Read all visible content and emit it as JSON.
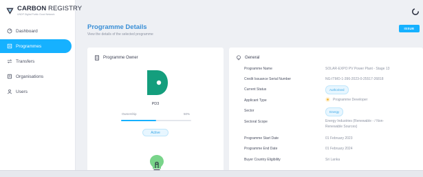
{
  "app": {
    "logo_title_bold": "CARBON",
    "logo_title_light": " REGISTRY",
    "logo_subtitle": "UNDP Digital Public Good Network"
  },
  "sidebar": {
    "items": [
      {
        "label": "Dashboard",
        "icon": "dashboard-icon",
        "active": false
      },
      {
        "label": "Programmes",
        "icon": "programmes-icon",
        "active": true
      },
      {
        "label": "Transfers",
        "icon": "transfers-icon",
        "active": false
      },
      {
        "label": "Organisations",
        "icon": "organisations-icon",
        "active": false
      },
      {
        "label": "Users",
        "icon": "users-icon",
        "active": false
      }
    ]
  },
  "header": {
    "title": "Programme Details",
    "subtitle": "View the details of the selected programme",
    "issue_label": "ISSUE"
  },
  "owner": {
    "heading": "Programme Owner",
    "name": "PD3",
    "ownership_label": "Ownership",
    "ownership_value": "50%",
    "ownership_fraction": 0.5,
    "status": "Active"
  },
  "general": {
    "heading": "General",
    "rows": [
      {
        "label": "Programme Name",
        "value": "SOLAR-EXPO PV Power Plant - Stage 13"
      },
      {
        "label": "Credit Issuance Serial Number",
        "value": "NG-ITMO-1-396-2023-0-25517-26818"
      },
      {
        "label": "Current Status",
        "value": "Authorised"
      },
      {
        "label": "Applicant Type",
        "value": "Programme Developer"
      },
      {
        "label": "Sector",
        "value": "Energy"
      },
      {
        "label": "Sectoral Scope",
        "value": "Energy Industries (Renewable - / Non-Renewable Sources)"
      },
      {
        "label": "Programme Start Date",
        "value": "01 February 2023"
      },
      {
        "label": "Programme End Date",
        "value": "01 February 2024"
      },
      {
        "label": "Buyer Country Eligibility",
        "value": "Sri Lanka"
      }
    ]
  },
  "colors": {
    "accent": "#16b1ff",
    "owner_logo": "#149e7d",
    "bulb": "#79d48a"
  }
}
